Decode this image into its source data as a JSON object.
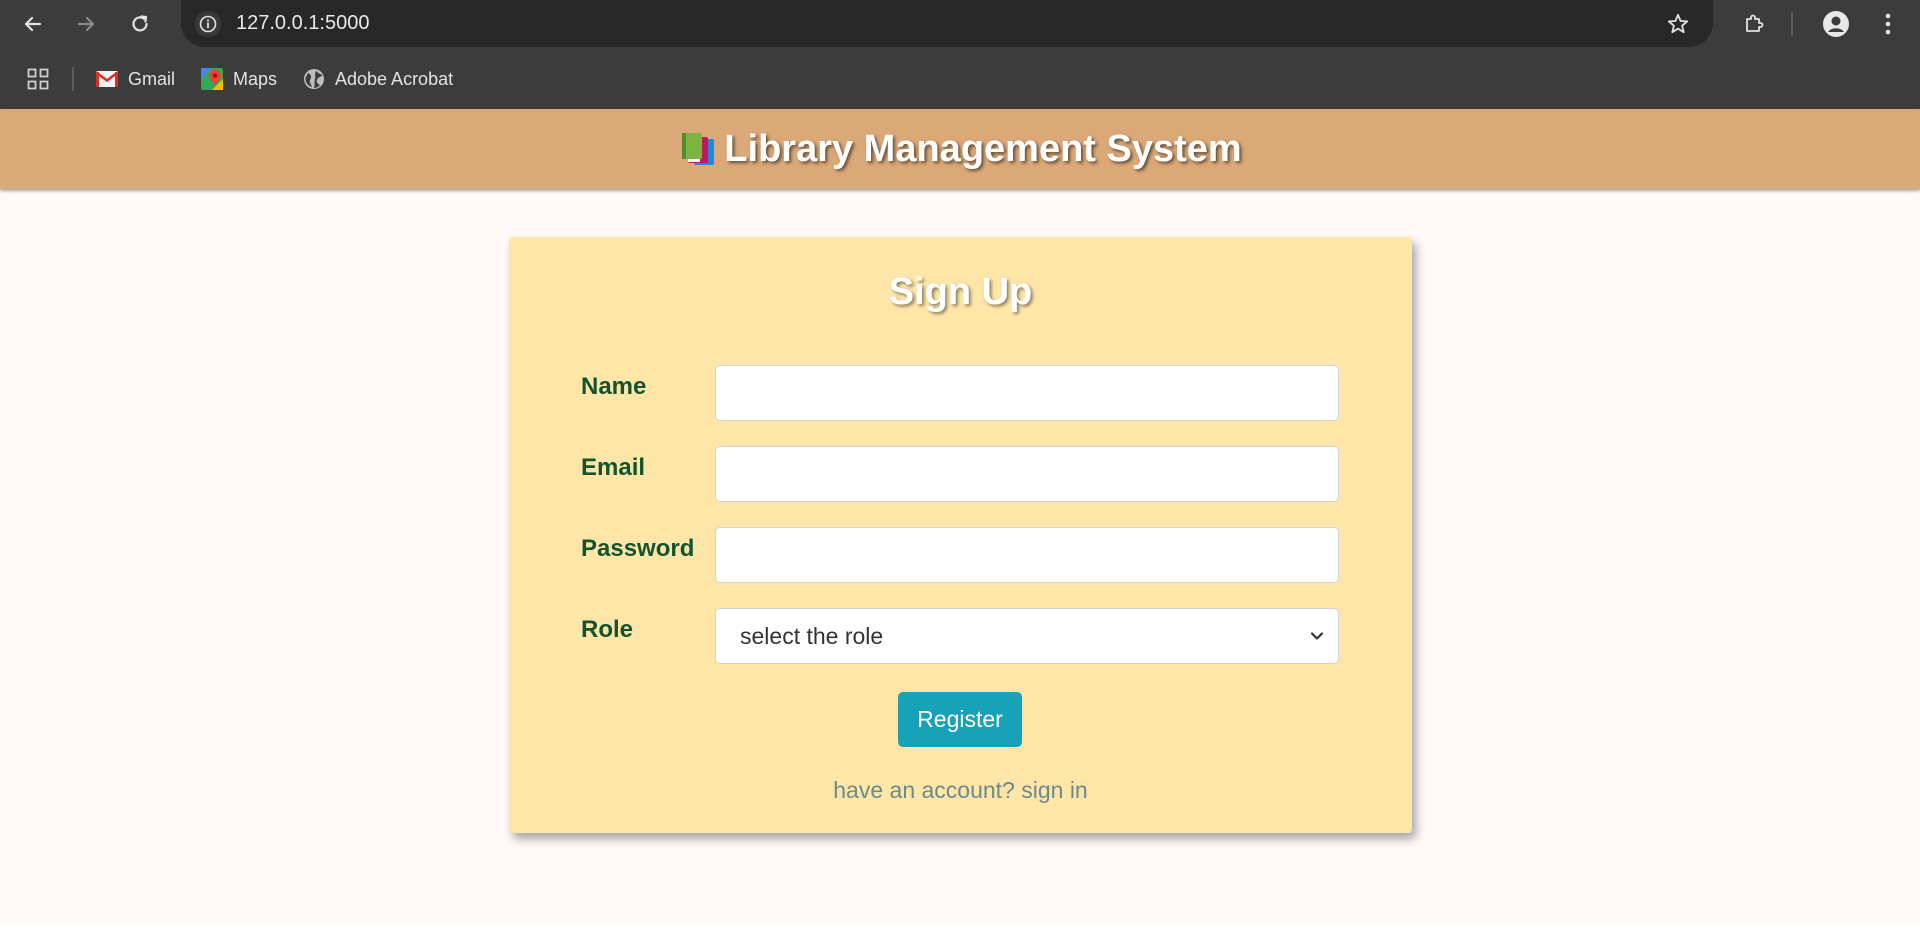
{
  "browser": {
    "url": "127.0.0.1:5000",
    "bookmarks": [
      {
        "label": "Gmail",
        "icon": "gmail-icon"
      },
      {
        "label": "Maps",
        "icon": "maps-icon"
      },
      {
        "label": "Adobe Acrobat",
        "icon": "globe-icon"
      }
    ]
  },
  "header": {
    "title": "Library Management System",
    "logo_icon": "books-icon",
    "background": "#dba878"
  },
  "form": {
    "title": "Sign Up",
    "fields": [
      {
        "label": "Name",
        "value": "",
        "type": "text"
      },
      {
        "label": "Email",
        "value": "",
        "type": "email"
      },
      {
        "label": "Password",
        "value": "",
        "type": "password"
      }
    ],
    "role": {
      "label": "Role",
      "selected": "select the role"
    },
    "submit_label": "Register",
    "signin_text": "have an account? sign in"
  },
  "colors": {
    "card": "#fee6a9",
    "label": "#14532d",
    "button": "#17a2b8"
  }
}
